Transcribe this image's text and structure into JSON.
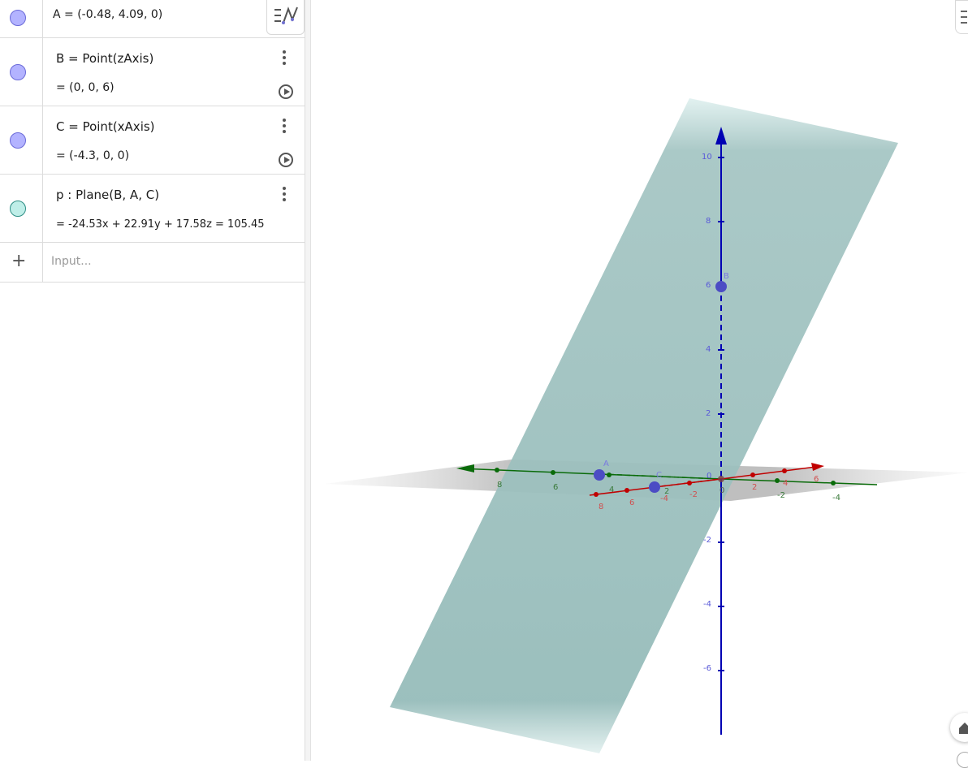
{
  "algebra": {
    "items": [
      {
        "def": "A = (-0.48, 4.09, 0)",
        "value": "",
        "color": "#b3b3ff"
      },
      {
        "def": "B  =  Point(zAxis)",
        "value": "=   (0, 0, 6)",
        "color": "#b3b3ff"
      },
      {
        "def": "C  =  Point(xAxis)",
        "value": "=   (-4.3, 0, 0)",
        "color": "#b3b3ff"
      },
      {
        "def": "p : Plane(B, A, C)",
        "value": "=   -24.53x  +  22.91y  +  17.58z  =  105.45",
        "color": "#bfeee8"
      }
    ],
    "input_placeholder": "Input...",
    "add_symbol": "+"
  },
  "graphics": {
    "colors": {
      "plane": "#8fb7b5",
      "point": "#4c4cc4",
      "z_axis": "#0000b3",
      "x_axis": "#c00000",
      "y_axis": "#006400"
    },
    "z_ticks": [
      "10",
      "8",
      "6",
      "4",
      "2",
      "0",
      "-2",
      "-4",
      "-6"
    ],
    "x_ticks": [
      "8",
      "6",
      "4",
      "2",
      "-2",
      "-4",
      "6",
      "-6"
    ],
    "y_ticks": [
      "8",
      "6",
      "4",
      "2",
      "-2",
      "-2",
      "-4",
      "6"
    ],
    "point_labels": {
      "A": "A",
      "B": "B",
      "C": "C"
    }
  }
}
